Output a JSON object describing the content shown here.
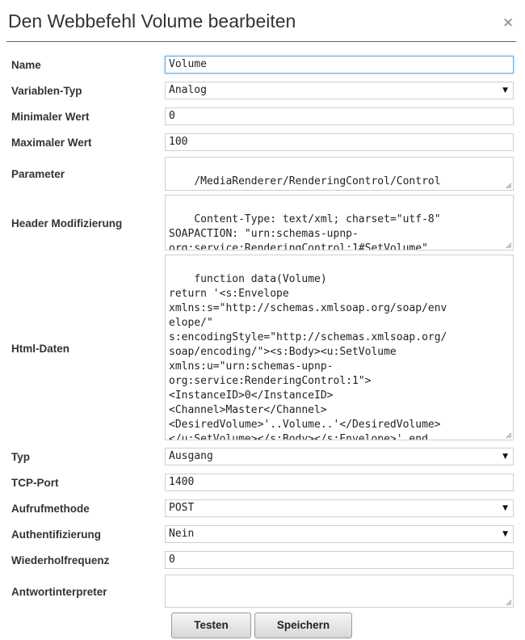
{
  "dialog": {
    "title": "Den Webbefehl Volume bearbeiten",
    "close": "×"
  },
  "fields": {
    "name": {
      "label": "Name",
      "value": "Volume"
    },
    "variable_type": {
      "label": "Variablen-Typ",
      "value": "Analog"
    },
    "min_value": {
      "label": "Minimaler Wert",
      "value": "0"
    },
    "max_value": {
      "label": "Maximaler Wert",
      "value": "100"
    },
    "parameter": {
      "label": "Parameter",
      "value": "/MediaRenderer/RenderingControl/Control"
    },
    "header": {
      "label": "Header Modifizierung",
      "value": "Content-Type: text/xml; charset=\"utf-8\"\nSOAPACTION: \"urn:schemas-upnp-\norg:service:RenderingControl:1#SetVolume\""
    },
    "html_data": {
      "label": "Html-Daten",
      "value": "function data(Volume)\nreturn '<s:Envelope\nxmlns:s=\"http://schemas.xmlsoap.org/soap/env\nelope/\"\ns:encodingStyle=\"http://schemas.xmlsoap.org/\nsoap/encoding/\"><s:Body><u:SetVolume\nxmlns:u=\"urn:schemas-upnp-\norg:service:RenderingControl:1\">\n<InstanceID>0</InstanceID>\n<Channel>Master</Channel>\n<DesiredVolume>'..Volume..'</DesiredVolume>\n</u:SetVolume></s:Body></s:Envelope>' end"
    },
    "type": {
      "label": "Typ",
      "value": "Ausgang"
    },
    "tcp_port": {
      "label": "TCP-Port",
      "value": "1400"
    },
    "call_method": {
      "label": "Aufrufmethode",
      "value": "POST"
    },
    "authentication": {
      "label": "Authentifizierung",
      "value": "Nein"
    },
    "repeat_frequency": {
      "label": "Wiederholfrequenz",
      "value": "0"
    },
    "response_interpreter": {
      "label": "Antwortinterpreter",
      "value": ""
    }
  },
  "buttons": {
    "test": "Testen",
    "save": "Speichern"
  },
  "icons": {
    "select_arrow": "triangle-down",
    "resize_grip": "resize-grip"
  }
}
